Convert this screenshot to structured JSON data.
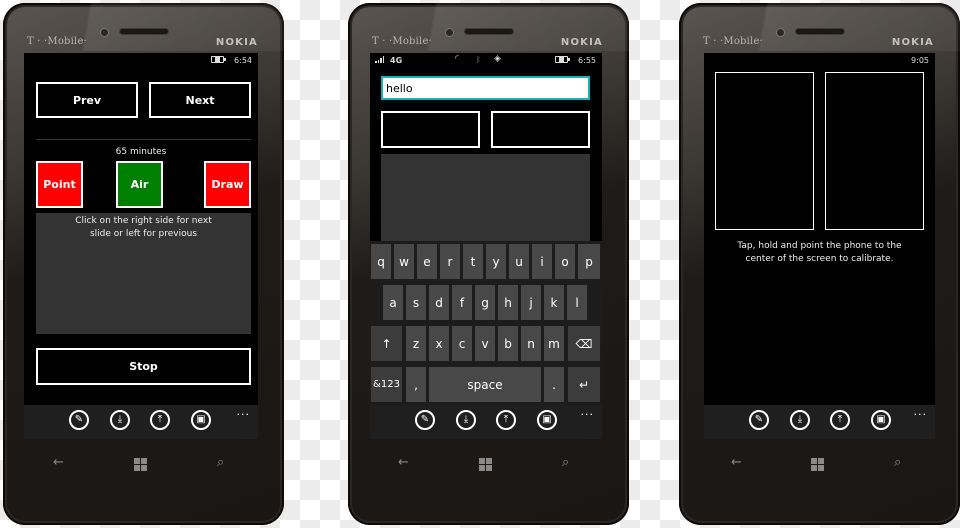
{
  "phones": [
    {
      "carrier": "T · ·Mobile·",
      "brand": "NOKIA",
      "status": {
        "time": "6:54",
        "battery": "charging"
      },
      "buttons": {
        "prev": "Prev",
        "next": "Next",
        "stop": "Stop"
      },
      "timer_label": "65 minutes",
      "modes": [
        {
          "label": "Point",
          "color": "#ff0000"
        },
        {
          "label": "Air",
          "color": "#008000"
        },
        {
          "label": "Draw",
          "color": "#ff0000"
        }
      ],
      "instruction": "Click on the right side for next slide or left for previous",
      "appbar": {
        "icons": [
          "edit-icon",
          "download-icon",
          "upload-icon",
          "window-icon"
        ],
        "more": "..."
      },
      "navkeys": [
        "back",
        "windows",
        "search"
      ]
    },
    {
      "carrier": "T · ·Mobile·",
      "brand": "NOKIA",
      "status": {
        "signal": "4G",
        "time": "6:55",
        "battery": "charging",
        "icons": [
          "wifi-icon",
          "bluetooth-icon",
          "location-icon"
        ]
      },
      "input": {
        "value": "hello",
        "accent": "#1bb1b8"
      },
      "keyboard": {
        "row1": [
          "q",
          "w",
          "e",
          "r",
          "t",
          "y",
          "u",
          "i",
          "o",
          "p"
        ],
        "row2": [
          "a",
          "s",
          "d",
          "f",
          "g",
          "h",
          "j",
          "k",
          "l"
        ],
        "row3": [
          "↑",
          "z",
          "x",
          "c",
          "v",
          "b",
          "n",
          "m",
          "⌫"
        ],
        "row4": [
          "&123",
          ",",
          "space",
          ".",
          "↵"
        ]
      },
      "appbar": {
        "icons": [
          "edit-icon",
          "download-icon",
          "upload-icon",
          "window-icon"
        ],
        "more": "..."
      },
      "navkeys": [
        "back",
        "windows",
        "search"
      ]
    },
    {
      "carrier": "T · ·Mobile·",
      "brand": "NOKIA",
      "status": {
        "time": "9:05"
      },
      "instruction": "Tap, hold and point the phone to the center of the screen to calibrate.",
      "appbar": {
        "icons": [
          "edit-icon",
          "download-icon",
          "upload-icon",
          "window-icon"
        ],
        "more": "..."
      },
      "navkeys": [
        "back",
        "windows",
        "search"
      ]
    }
  ],
  "glyphs": {
    "back": "←",
    "search": "⌕",
    "edit": "✎",
    "download": "⤓",
    "upload": "⤒",
    "window": "▣"
  }
}
